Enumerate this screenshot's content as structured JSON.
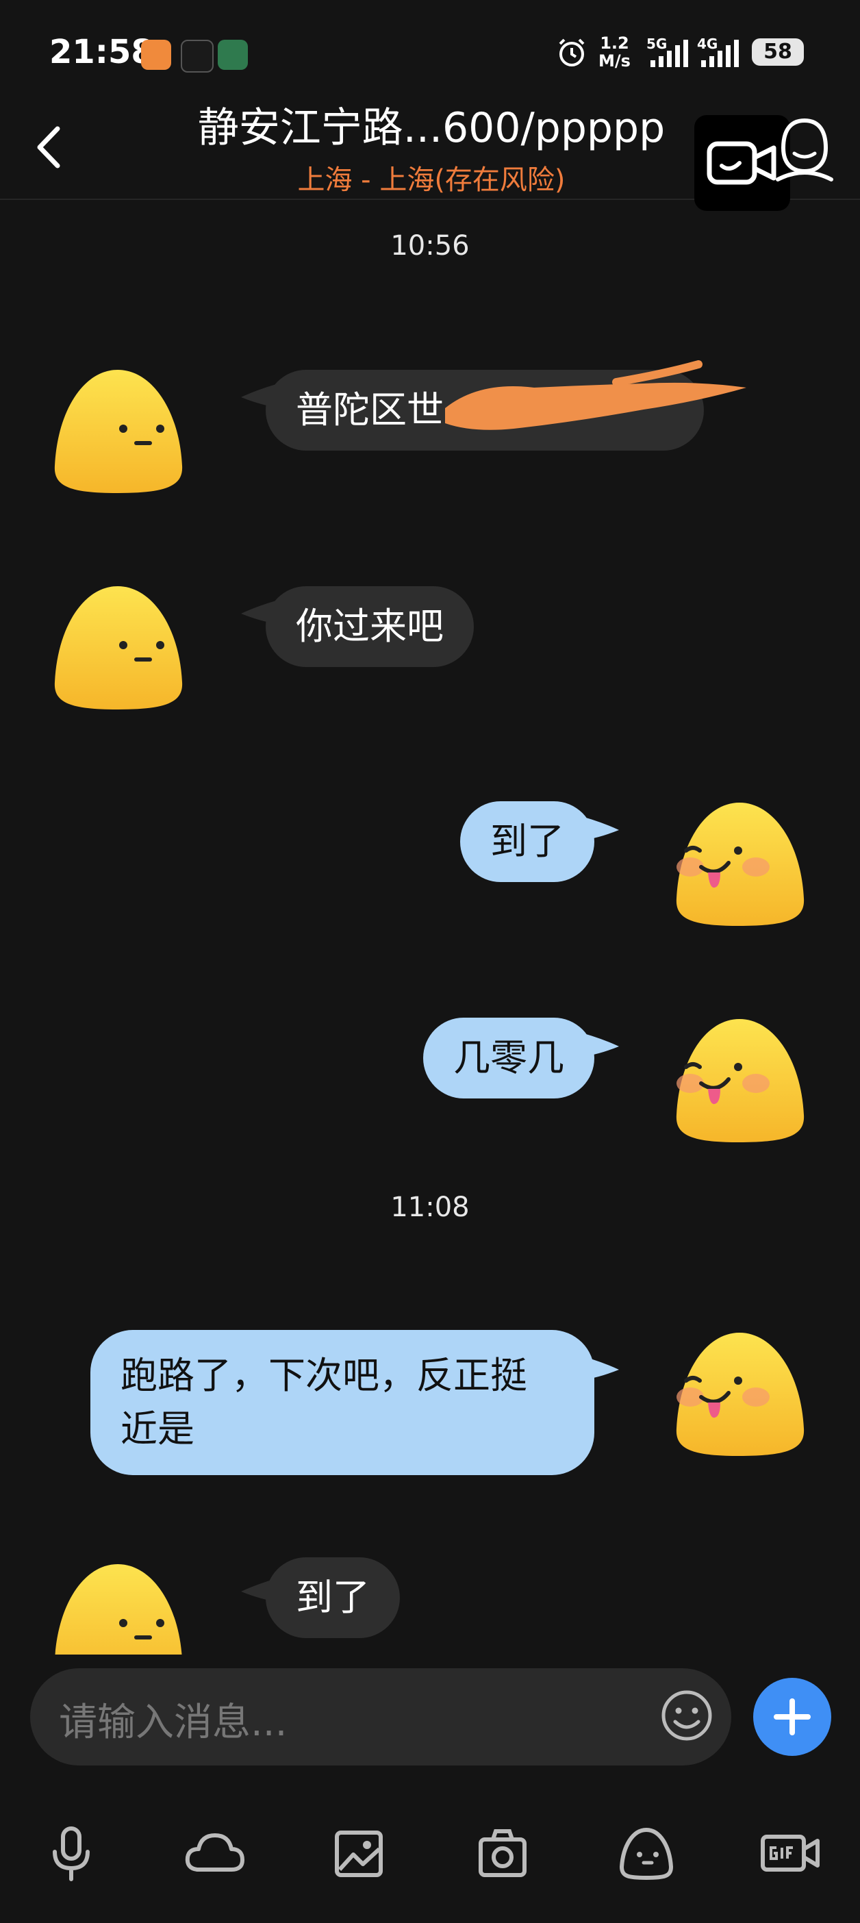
{
  "status_bar": {
    "time": "21:58",
    "net_speed_top": "1.2",
    "net_speed_unit": "M/s",
    "sig1": "5G",
    "sig2": "4G",
    "battery": "58"
  },
  "header": {
    "title": "静安江宁路...600/ppppp",
    "subtitle": "上海 - 上海(存在风险)",
    "subtitle_color": "#f07c3c"
  },
  "messages": {
    "ts1": "10:56",
    "m1": "普陀区世",
    "m2": "你过来吧",
    "m3": "到了",
    "m4": "几零几",
    "ts2": "11:08",
    "m5_line1": "跑路了，下次吧，反正挺",
    "m5_line2": "近是",
    "m6": "到了"
  },
  "input": {
    "placeholder": "请输入消息..."
  },
  "toolbar": {
    "icons": [
      "microphone-icon",
      "cloud-icon",
      "image-icon",
      "camera-icon",
      "sticker-icon",
      "gif-icon"
    ]
  },
  "colors": {
    "background": "#141414",
    "incoming_bubble": "#2e2e2e",
    "outgoing_bubble": "#aed5f7",
    "accent": "#3f8ff5",
    "redaction": "#f0904a"
  }
}
